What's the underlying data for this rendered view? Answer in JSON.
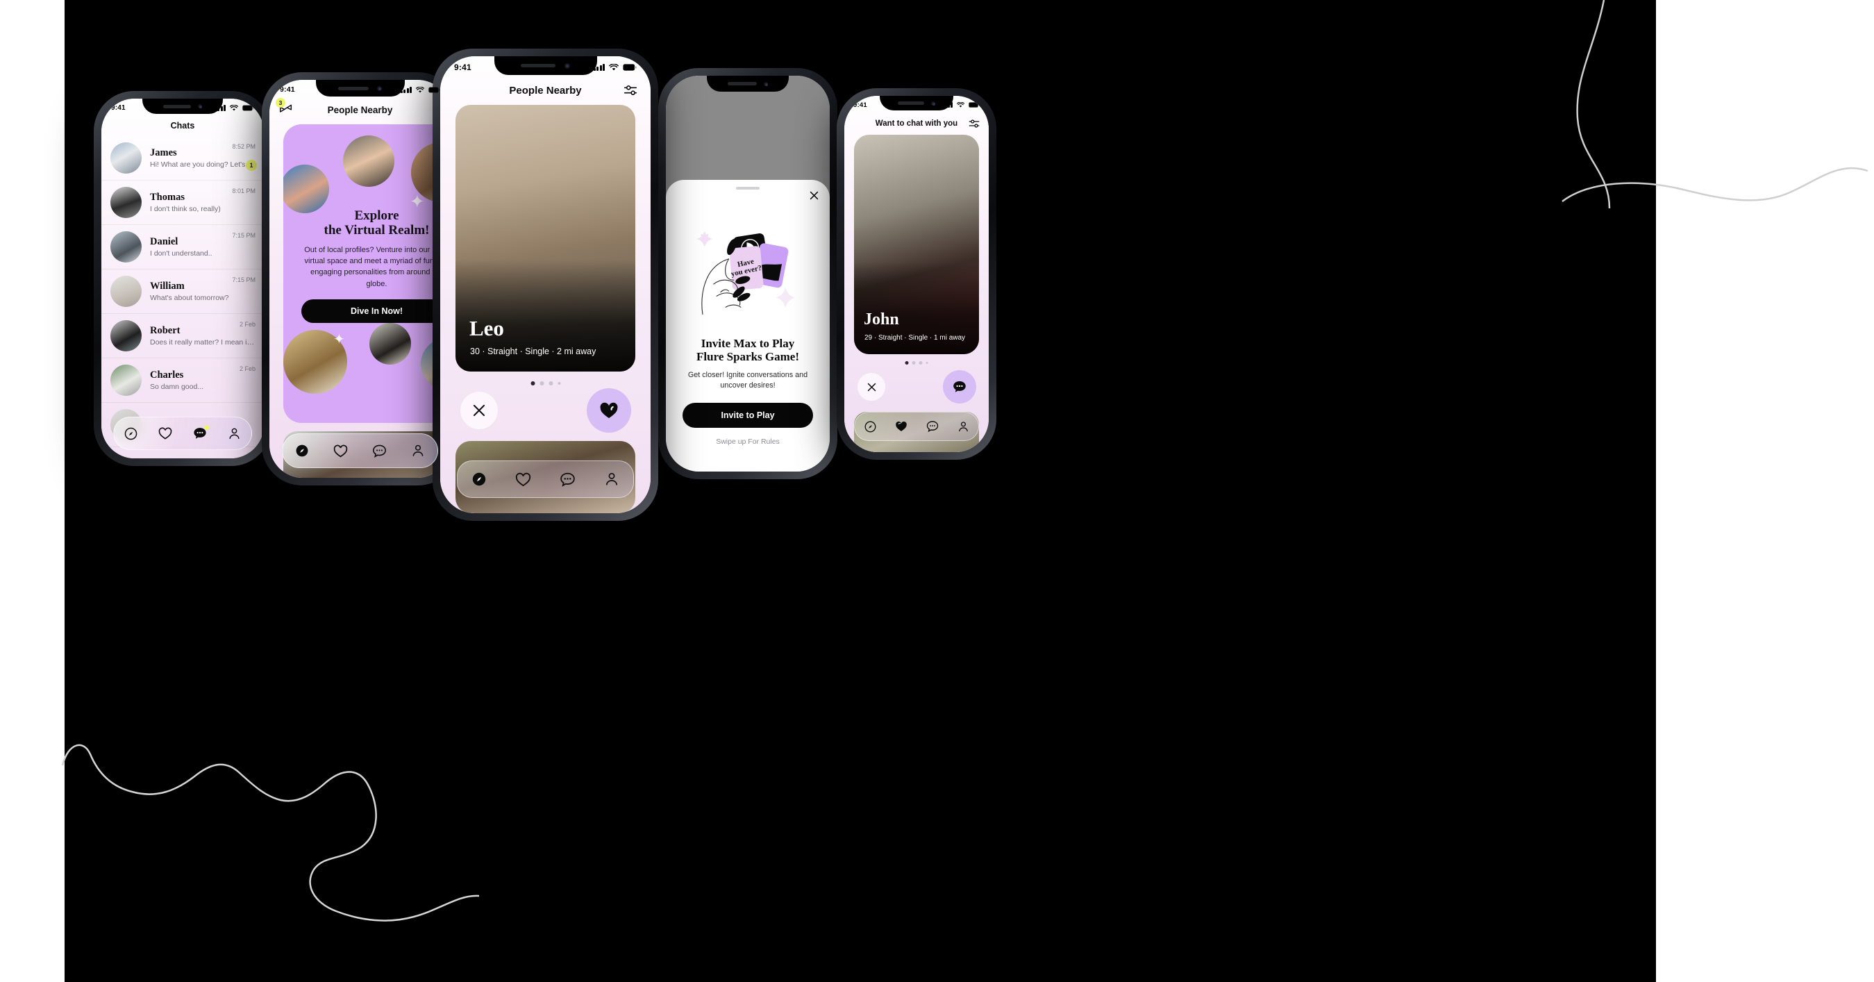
{
  "background": {
    "canvas_color": "#000000",
    "page_color": "#ffffff",
    "accent_purple": "#D6A8F7",
    "accent_lilac": "#D7BDF5",
    "accent_yellow": "#EFF56B"
  },
  "phones": [
    {
      "id": "phone-chats",
      "status_bar": {
        "time": "9:41"
      },
      "header": {
        "title": "Chats"
      },
      "chats": [
        {
          "name": "James",
          "message": "Hi! What are you doing? Let's...",
          "time": "8:52 PM",
          "unread": "1"
        },
        {
          "name": "Thomas",
          "message": "I don't think so, really)",
          "time": "8:01 PM",
          "unread": ""
        },
        {
          "name": "Daniel",
          "message": "I don't understand..",
          "time": "7:15 PM",
          "unread": ""
        },
        {
          "name": "William",
          "message": "What's about tomorrow?",
          "time": "7:15 PM",
          "unread": ""
        },
        {
          "name": "Robert",
          "message": "Does it really matter? I mean if...",
          "time": "2 Feb",
          "unread": ""
        },
        {
          "name": "Charles",
          "message": "So damn good...",
          "time": "2 Feb",
          "unread": ""
        }
      ],
      "tabs": [
        {
          "icon": "compass-icon",
          "label": "Explore",
          "active": true,
          "dot": false
        },
        {
          "icon": "heart-icon",
          "label": "Likes",
          "active": false,
          "dot": false
        },
        {
          "icon": "chat-icon",
          "label": "Chats",
          "active": true,
          "dot": true
        },
        {
          "icon": "profile-icon",
          "label": "Profile",
          "active": false,
          "dot": false
        }
      ]
    },
    {
      "id": "phone-virtual-realm",
      "status_bar": {
        "time": "9:41"
      },
      "header": {
        "title": "People Nearby",
        "left_icon": "bowtie-icon",
        "left_badge": "3"
      },
      "promo": {
        "title_line1": "Explore",
        "title_line2": "the Virtual Realm!",
        "body": "Out of local profiles? Venture into our lively virtual space and meet a myriad of fun and engaging personalities from around the globe.",
        "cta_label": "Dive In Now!"
      },
      "tabs": [
        {
          "icon": "compass-icon",
          "label": "Explore",
          "active": true
        },
        {
          "icon": "heart-icon",
          "label": "Likes",
          "active": false
        },
        {
          "icon": "chat-icon",
          "label": "Chats",
          "active": false
        },
        {
          "icon": "profile-icon",
          "label": "Profile",
          "active": false
        }
      ]
    },
    {
      "id": "phone-people-nearby",
      "status_bar": {
        "time": "9:41"
      },
      "header": {
        "title": "People Nearby",
        "right_icon": "filter-sliders-icon"
      },
      "profile": {
        "name": "Leo",
        "meta": "30 · Straight · Single · 2 mi away",
        "age": "30",
        "orientation": "Straight",
        "status": "Single",
        "distance": "2 mi away",
        "carousel_dots": 4,
        "carousel_active": 1
      },
      "actions": [
        {
          "icon": "close-x-icon",
          "label": "Pass"
        },
        {
          "icon": "heart-filled-icon",
          "label": "Like"
        }
      ],
      "tabs": [
        {
          "icon": "compass-icon",
          "label": "Explore",
          "active": true
        },
        {
          "icon": "heart-icon",
          "label": "Likes",
          "active": false
        },
        {
          "icon": "chat-icon",
          "label": "Chats",
          "active": false
        },
        {
          "icon": "profile-icon",
          "label": "Profile",
          "active": false
        }
      ]
    },
    {
      "id": "phone-sparks-modal",
      "modal": {
        "illustration_card_text_line1": "Have",
        "illustration_card_text_line2": "you ever?",
        "title_line1": "Invite Max to Play",
        "title_line2": "Flure Sparks Game!",
        "subtitle": "Get closer! Ignite conversations and uncover desires!",
        "primary_button": "Invite to Play",
        "secondary_link": "Swipe up For Rules",
        "close_icon": "close-x-icon"
      }
    },
    {
      "id": "phone-want-to-chat",
      "status_bar": {
        "time": "9:41"
      },
      "header": {
        "title": "Want to chat with you",
        "right_icon": "filter-sliders-icon"
      },
      "profile": {
        "name": "John",
        "meta": "29 · Straight · Single · 1 mi away",
        "age": "29",
        "orientation": "Straight",
        "status": "Single",
        "distance": "1 mi away",
        "carousel_dots": 4,
        "carousel_active": 1
      },
      "actions": [
        {
          "icon": "close-x-icon",
          "label": "Pass"
        },
        {
          "icon": "chat-filled-icon",
          "label": "Message"
        }
      ],
      "tabs": [
        {
          "icon": "compass-icon",
          "label": "Explore",
          "active": false
        },
        {
          "icon": "heart-filled-icon",
          "label": "Likes",
          "active": true
        },
        {
          "icon": "chat-icon",
          "label": "Chats",
          "active": false
        },
        {
          "icon": "profile-icon",
          "label": "Profile",
          "active": false
        }
      ]
    }
  ]
}
